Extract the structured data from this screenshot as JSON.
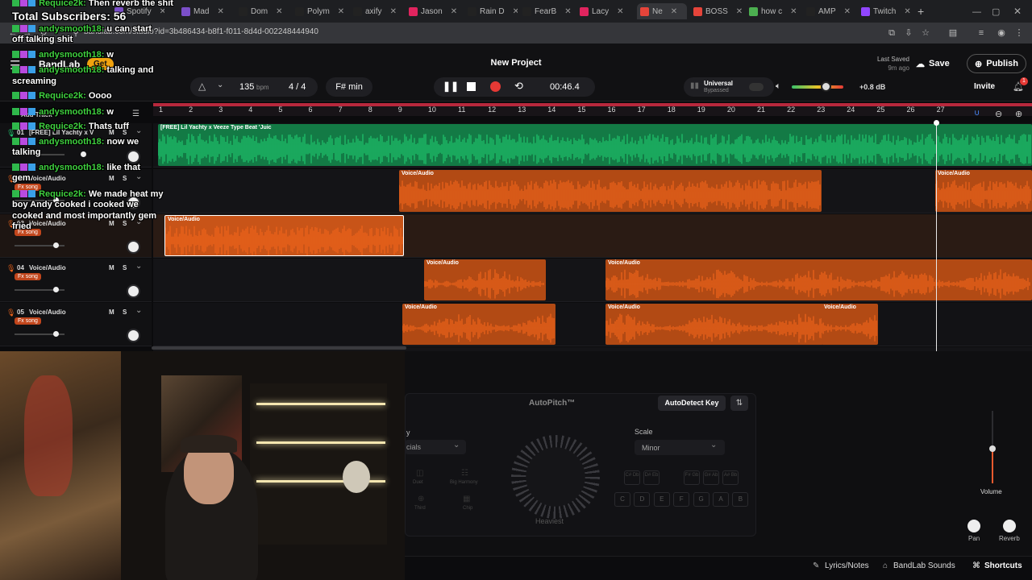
{
  "browser": {
    "tabs": [
      {
        "label": "Spotify",
        "color": "#7b4fc9"
      },
      {
        "label": "Mad",
        "color": "#7b4fc9"
      },
      {
        "label": "Dom",
        "color": "#222"
      },
      {
        "label": "Polym",
        "color": "#222"
      },
      {
        "label": "axify",
        "color": "#222"
      },
      {
        "label": "Jason",
        "color": "#e0245e"
      },
      {
        "label": "Rain D",
        "color": "#222"
      },
      {
        "label": "FearB",
        "color": "#222"
      },
      {
        "label": "Lacy",
        "color": "#e0245e"
      },
      {
        "label": "Ne",
        "color": "#e5443a"
      },
      {
        "label": "BOSS",
        "color": "#e5443a"
      },
      {
        "label": "how c",
        "color": "#4caf50"
      },
      {
        "label": "AMP",
        "color": "#222"
      },
      {
        "label": "Twitch",
        "color": "#9146ff"
      }
    ],
    "new_tab": "+",
    "url": "bandlab.com/studio?id=3b486434-b8f1-f011-8d4d-002248444940"
  },
  "app": {
    "logo": "BandLab",
    "get_badge": "Get",
    "project_title": "New Project",
    "last_saved_label": "Last Saved",
    "last_saved_value": "9m ago",
    "save": "Save",
    "publish": "Publish",
    "invite": "Invite",
    "notification_count": "1"
  },
  "transport": {
    "bpm": "135",
    "bpm_unit": "bpm",
    "time_sig": "4 / 4",
    "key": "F# min",
    "time": "00:46.4",
    "universal": "Universal",
    "bypassed": "Bypassed",
    "volume_db": "+0.8 dB"
  },
  "ruler": [
    "1",
    "2",
    "3",
    "4",
    "5",
    "6",
    "7",
    "8",
    "9",
    "10",
    "11",
    "12",
    "13",
    "14",
    "15",
    "16",
    "17",
    "18",
    "19",
    "20",
    "21",
    "22",
    "23",
    "24",
    "25",
    "26",
    "27"
  ],
  "tracks": [
    {
      "num": "01",
      "name": "[FREE] Lil Yachty x V",
      "fx": "",
      "clip_label": "[FREE] Lil Yachty x Veeze Type Beat 'Juic",
      "color": "#1fc66e"
    },
    {
      "num": "02",
      "name": "Voice/Audio",
      "fx": "Fx song",
      "clip_label": "Voice/Audio",
      "color": "#f0641a"
    },
    {
      "num": "03",
      "name": "Voice/Audio",
      "fx": "Fx song",
      "clip_label": "Voice/Audio",
      "color": "#f0641a"
    },
    {
      "num": "04",
      "name": "Voice/Audio",
      "fx": "Fx song",
      "clip_label": "Voice/Audio",
      "color": "#f0641a"
    },
    {
      "num": "05",
      "name": "Voice/Audio",
      "fx": "Fx song",
      "clip_label": "Voice/Audio",
      "color": "#f0641a"
    }
  ],
  "track_buttons": {
    "mute": "M",
    "solo": "S"
  },
  "add_track": "Add Track",
  "chat": [
    {
      "name": "Requice2k:",
      "msg": "Then reverb the shit"
    },
    {
      "name": "",
      "msg": "Total Subscribers: 56"
    },
    {
      "name": "andysmooth18:",
      "msg": "u can start"
    },
    {
      "name": "",
      "msg": "off talking shit"
    },
    {
      "name": "andysmooth18:",
      "msg": "w"
    },
    {
      "name": "andysmooth18:",
      "msg": "talking and"
    },
    {
      "name": "",
      "msg": "screaming"
    },
    {
      "name": "Requice2k:",
      "msg": "Oooo"
    },
    {
      "name": "andysmooth18:",
      "msg": "w"
    },
    {
      "name": "Requice2k:",
      "msg": "Thats tuff"
    },
    {
      "name": "andysmooth18:",
      "msg": "now we"
    },
    {
      "name": "",
      "msg": "talking"
    },
    {
      "name": "andysmooth18:",
      "msg": "like that"
    },
    {
      "name": "",
      "msg": "gem"
    },
    {
      "name": "Requice2k:",
      "msg": "We made heat my"
    },
    {
      "name": "",
      "msg": "boy Andy cooked i cooked we"
    },
    {
      "name": "",
      "msg": "cooked and most importantly gem"
    },
    {
      "name": "",
      "msg": "fried"
    }
  ],
  "panel": {
    "left_label": "y",
    "left_select": "cials",
    "presets": [
      "Duet",
      "Big Harmony",
      "Third",
      "Chip"
    ],
    "autopitch": "AutoPitch™",
    "autodetect": "AutoDetect Key",
    "scale_label": "Scale",
    "scale_value": "Minor",
    "knob_label": "Heaviest",
    "notes_top": [
      "C# Db",
      "D# Eb",
      "F# Gb",
      "G# Ab",
      "A# Bb"
    ],
    "notes_bottom": [
      "C",
      "D",
      "E",
      "F",
      "G",
      "A",
      "B"
    ],
    "volume": "Volume",
    "pan": "Pan",
    "reverb": "Reverb",
    "lyrics": "Lyrics/Notes",
    "sounds": "BandLab Sounds",
    "shortcuts": "Shortcuts"
  }
}
